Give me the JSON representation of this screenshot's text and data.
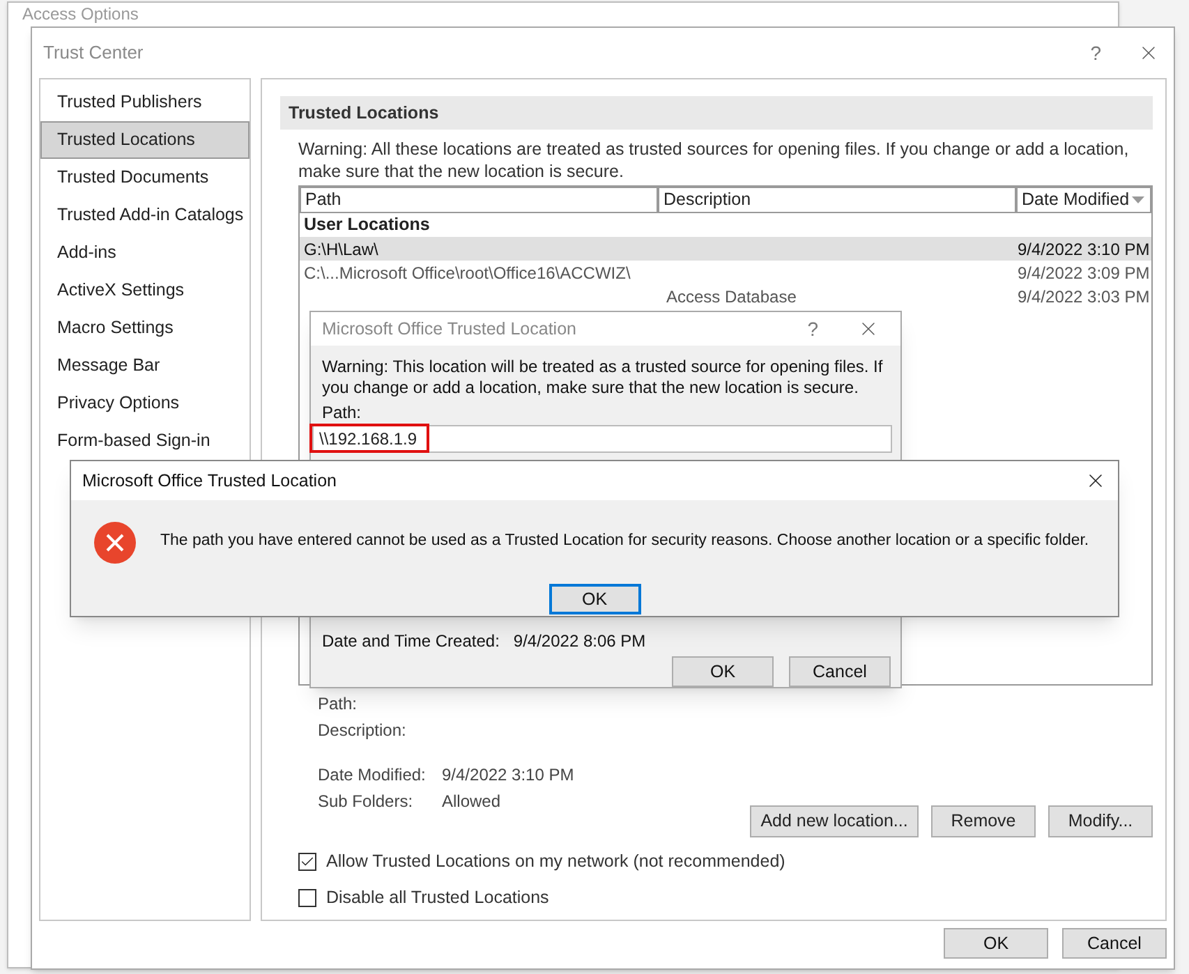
{
  "background_window": {
    "title": "Access Options"
  },
  "window": {
    "title": "Trust Center",
    "help": "?"
  },
  "sidebar": {
    "items": [
      {
        "label": "Trusted Publishers",
        "selected": false
      },
      {
        "label": "Trusted Locations",
        "selected": true
      },
      {
        "label": "Trusted Documents",
        "selected": false
      },
      {
        "label": "Trusted Add-in Catalogs",
        "selected": false
      },
      {
        "label": "Add-ins",
        "selected": false
      },
      {
        "label": "ActiveX Settings",
        "selected": false
      },
      {
        "label": "Macro Settings",
        "selected": false
      },
      {
        "label": "Message Bar",
        "selected": false
      },
      {
        "label": "Privacy Options",
        "selected": false
      },
      {
        "label": "Form-based Sign-in",
        "selected": false
      }
    ]
  },
  "section": {
    "title": "Trusted Locations",
    "warning": "Warning: All these locations are treated as trusted sources for opening files.  If you change or add a location, make sure that the new location is secure."
  },
  "table": {
    "columns": [
      "Path",
      "Description",
      "Date Modified"
    ],
    "group": "User Locations",
    "rows": [
      {
        "path": "G:\\H\\Law\\",
        "date": "9/4/2022 3:10 PM",
        "selected": true
      },
      {
        "path": "C:\\...Microsoft Office\\root\\Office16\\ACCWIZ\\",
        "date": "9/4/2022 3:09 PM",
        "selected": false
      },
      {
        "description": "Access Database",
        "date": "9/4/2022 3:03 PM",
        "selected": false
      }
    ]
  },
  "details": [
    {
      "label": "Path:"
    },
    {
      "label": "Description:"
    },
    {
      "label": "Date Modified:",
      "value": "9/4/2022 3:10 PM"
    },
    {
      "label": "Sub Folders:",
      "value": "Allowed"
    }
  ],
  "actions": [
    "Add new location...",
    "Remove",
    "Modify..."
  ],
  "checkboxes": [
    {
      "label": "Allow Trusted Locations on my network (not recommended)",
      "checked": true
    },
    {
      "label": "Disable all Trusted Locations",
      "checked": false
    }
  ],
  "footer_buttons": [
    "OK",
    "Cancel"
  ],
  "location_dialog": {
    "title": "Microsoft Office Trusted Location",
    "help": "?",
    "warning": "Warning: This location will be treated as a trusted source for opening files. If you change or add a location, make sure that the new location is secure.",
    "path_label": "Path:",
    "path_value": "\\\\192.168.1.9",
    "created_label": "Date and Time Created:",
    "created_value": "9/4/2022 8:06 PM",
    "buttons": [
      "OK",
      "Cancel"
    ]
  },
  "error_dialog": {
    "title": "Microsoft Office Trusted Location",
    "message": "The path you have entered cannot be used as a Trusted Location for security reasons.  Choose another location or a specific folder.",
    "button": "OK"
  }
}
